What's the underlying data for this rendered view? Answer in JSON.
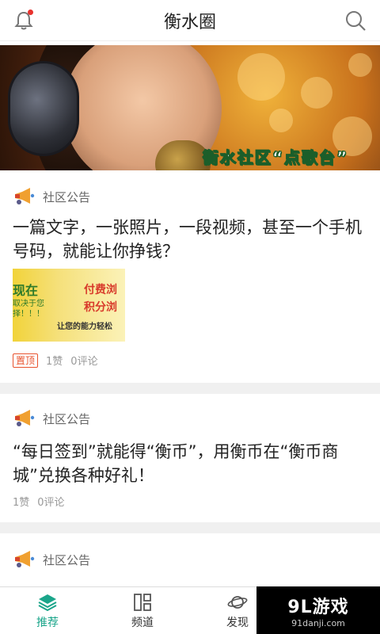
{
  "header": {
    "title": "衡水圈",
    "bell_icon": "bell-icon",
    "search_icon": "search-icon",
    "accent": "#e8322d"
  },
  "banner": {
    "caption": "衡水社区“点歌台”",
    "slides": 2,
    "active_slide": 1
  },
  "feed": [
    {
      "source": "社区公告",
      "headline": "一篇文字，一张照片，一段视频，甚至一个手机号码，就能让你挣钱？",
      "pin_label": "置顶",
      "likes": "1赞",
      "comments": "0评论",
      "thumb": {
        "line1": "现在",
        "line2": "取决于您\n择！！！",
        "line3": "付费浏",
        "line4": "积分浏",
        "line5": "让您的能力轻松"
      }
    },
    {
      "source": "社区公告",
      "headline": "“每日签到”就能得“衡币”，用衡币在“衡币商城”兑换各种好礼！",
      "likes": "1赞",
      "comments": "0评论"
    },
    {
      "source": "社区公告"
    }
  ],
  "nav": {
    "items": [
      {
        "label": "推荐",
        "icon": "layers-icon",
        "active": true
      },
      {
        "label": "频道",
        "icon": "channel-grid-icon",
        "active": false
      },
      {
        "label": "发现",
        "icon": "planet-icon",
        "active": false
      }
    ],
    "active_color": "#1aa58a"
  },
  "watermark": {
    "brand_num": "9L",
    "brand_text": "游戏",
    "domain": "91danji.com"
  }
}
